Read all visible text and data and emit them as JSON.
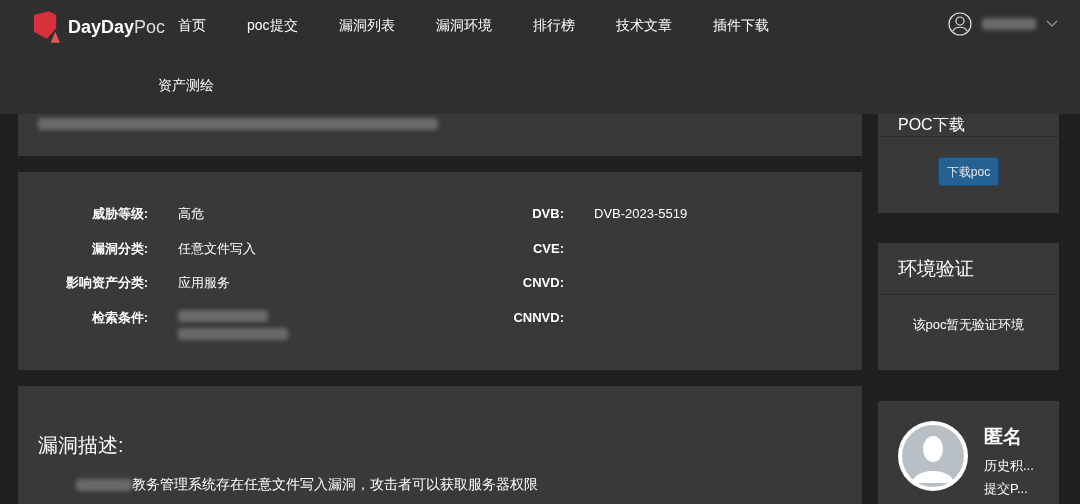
{
  "header": {
    "logo": {
      "part1": "DayDay",
      "part2": "Poc"
    },
    "nav": [
      "首页",
      "poc提交",
      "漏洞列表",
      "漏洞环境",
      "排行榜",
      "技术文章",
      "插件下载",
      "资产测绘"
    ]
  },
  "info": {
    "left": [
      {
        "label": "威胁等级:",
        "value": "高危"
      },
      {
        "label": "漏洞分类:",
        "value": "任意文件写入"
      },
      {
        "label": "影响资产分类:",
        "value": "应用服务"
      },
      {
        "label": "检索条件:",
        "redacted": true
      }
    ],
    "right": [
      {
        "label": "DVB:",
        "value": "DVB-2023-5519"
      },
      {
        "label": "CVE:"
      },
      {
        "label": "CNVD:"
      },
      {
        "label": "CNNVD:"
      }
    ]
  },
  "description": {
    "title": "漏洞描述:",
    "text": "教务管理系统存在任意文件写入漏洞，攻击者可以获取服务器权限"
  },
  "download": {
    "title": "POC下载",
    "button": "下载poc"
  },
  "env": {
    "title": "环境验证",
    "text": "该poc暂无验证环境"
  },
  "author": {
    "name": "匿名",
    "lines": [
      "历史积...",
      "提交P..."
    ]
  }
}
